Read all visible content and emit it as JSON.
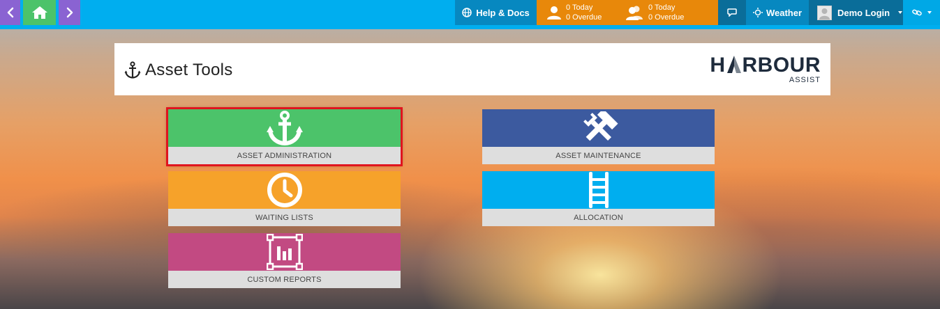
{
  "topbar": {
    "help_label": "Help & Docs",
    "notif_personal": {
      "today": "0 Today",
      "overdue": "0 Overdue"
    },
    "notif_group": {
      "today": "0 Today",
      "overdue": "0 Overdue"
    },
    "weather_label": "Weather",
    "user_label": "Demo Login"
  },
  "header": {
    "title": "Asset Tools",
    "logo_main": "H BOUR",
    "logo_main_prefix": "H",
    "logo_main_suffix": "RBOUR",
    "logo_sub": "ASSIST"
  },
  "tiles": [
    {
      "label": "ASSET ADMINISTRATION",
      "color": "#4cc36a",
      "icon": "anchor-icon",
      "selected": true
    },
    {
      "label": "ASSET MAINTENANCE",
      "color": "#3c5a9f",
      "icon": "tools-icon",
      "selected": false
    },
    {
      "label": "WAITING LISTS",
      "color": "#f6a22a",
      "icon": "clock-icon",
      "selected": false
    },
    {
      "label": "ALLOCATION",
      "color": "#00aeef",
      "icon": "ladder-icon",
      "selected": false
    },
    {
      "label": "CUSTOM REPORTS",
      "color": "#c24a82",
      "icon": "report-chart-icon",
      "selected": false
    }
  ],
  "colors": {
    "topbar": "#00aeef",
    "nav_purple": "#8a63d2",
    "nav_green": "#4cc36a",
    "notif_orange": "#e8880a",
    "selected_outline": "#e0141e"
  }
}
